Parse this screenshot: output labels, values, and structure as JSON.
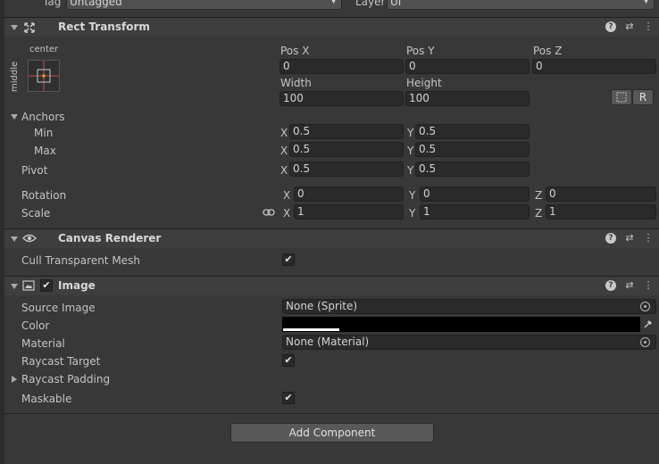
{
  "top": {
    "tag_label": "Tag",
    "tag_value": "Untagged",
    "layer_label": "Layer",
    "layer_value": "UI"
  },
  "rect_transform": {
    "title": "Rect Transform",
    "anchor_preset": {
      "h_label": "center",
      "v_label": "middle"
    },
    "pos_x_label": "Pos X",
    "pos_y_label": "Pos Y",
    "pos_z_label": "Pos Z",
    "pos_x": "0",
    "pos_y": "0",
    "pos_z": "0",
    "width_label": "Width",
    "height_label": "Height",
    "width": "100",
    "height": "100",
    "raw_button": "R",
    "anchors_label": "Anchors",
    "min_label": "Min",
    "max_label": "Max",
    "min_x": "0.5",
    "min_y": "0.5",
    "max_x": "0.5",
    "max_y": "0.5",
    "pivot_label": "Pivot",
    "pivot_x": "0.5",
    "pivot_y": "0.5",
    "rotation_label": "Rotation",
    "rot_x": "0",
    "rot_y": "0",
    "rot_z": "0",
    "scale_label": "Scale",
    "scale_x": "1",
    "scale_y": "1",
    "scale_z": "1",
    "axis_x": "X",
    "axis_y": "Y",
    "axis_z": "Z"
  },
  "canvas_renderer": {
    "title": "Canvas Renderer",
    "cull_label": "Cull Transparent Mesh",
    "cull_checked": true
  },
  "image": {
    "title": "Image",
    "source_image_label": "Source Image",
    "source_image_value": "None (Sprite)",
    "color_label": "Color",
    "color_value": "#000000",
    "material_label": "Material",
    "material_value": "None (Material)",
    "raycast_target_label": "Raycast Target",
    "raycast_target_checked": true,
    "raycast_padding_label": "Raycast Padding",
    "maskable_label": "Maskable",
    "maskable_checked": true
  },
  "add_component_label": "Add Component",
  "icons": [
    "help-icon",
    "preset-icon",
    "more-icon",
    "eye-icon",
    "image-component-icon",
    "link-icon",
    "object-picker-icon",
    "eyedropper-icon",
    "blueprint-icon"
  ],
  "colors": {
    "bg": "#383838",
    "header": "#3e3e3e",
    "field": "#2a2a2a",
    "text": "#c4c4c4"
  }
}
